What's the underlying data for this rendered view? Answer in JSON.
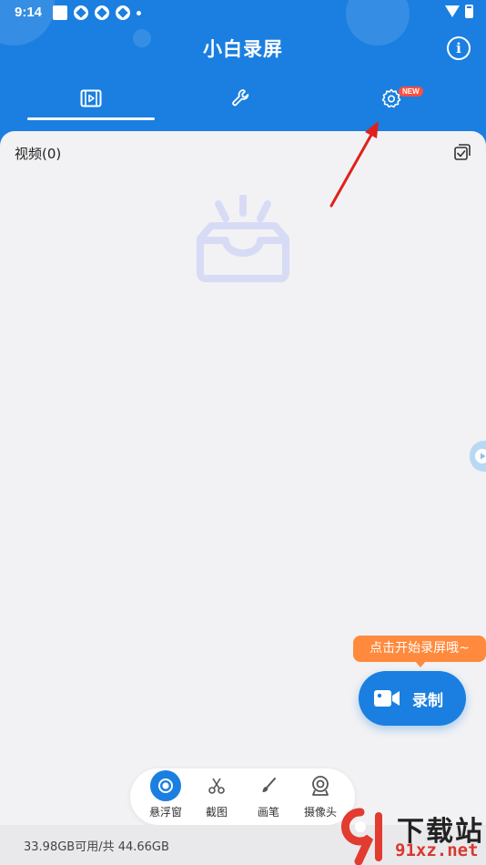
{
  "status": {
    "time": "9:14"
  },
  "app": {
    "title": "小白录屏"
  },
  "tabs": [
    {
      "icon": "video-list-icon",
      "selected": true
    },
    {
      "icon": "wrench-icon",
      "selected": false
    },
    {
      "icon": "gear-icon",
      "selected": false,
      "badge": "NEW"
    }
  ],
  "content": {
    "section_label": "视频(0)"
  },
  "record": {
    "tooltip": "点击开始录屏哦~",
    "label": "录制"
  },
  "toolbar": [
    {
      "label": "悬浮窗",
      "icon": "floating-window-icon",
      "active": true
    },
    {
      "label": "截图",
      "icon": "scissors-icon",
      "active": false
    },
    {
      "label": "画笔",
      "icon": "brush-icon",
      "active": false
    },
    {
      "label": "摄像头",
      "icon": "webcam-icon",
      "active": false
    }
  ],
  "storage": {
    "text": "33.98GB可用/共 44.66GB"
  },
  "watermark": {
    "title": "下载站",
    "url": "91xz.net"
  },
  "colors": {
    "primary": "#1a7fe0",
    "accent": "#ff8a3d",
    "badge": "#ff4f3f",
    "background": "#f2f2f4",
    "annotation_arrow": "#e0201c"
  }
}
